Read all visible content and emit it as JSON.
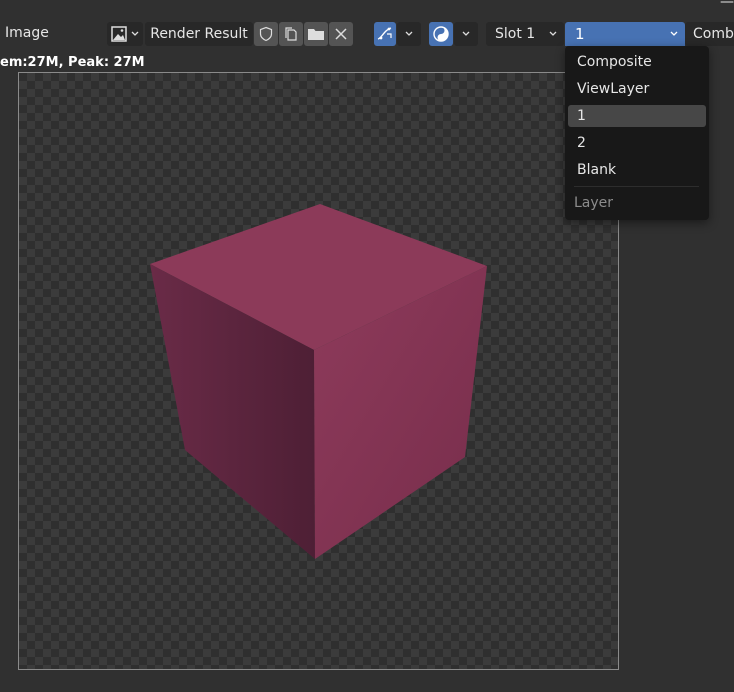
{
  "header": {
    "menu_label": "Image",
    "image_name": "Render Result",
    "slot_label": "Slot 1",
    "layer_selected": "1",
    "pass_label": "Combi",
    "window_minimize": "—"
  },
  "status": {
    "memory_text": "em:27M, Peak: 27M"
  },
  "layer_dropdown": {
    "items": [
      {
        "label": "Composite",
        "active": false
      },
      {
        "label": "ViewLayer",
        "active": false
      },
      {
        "label": "1",
        "active": true
      },
      {
        "label": "2",
        "active": false
      },
      {
        "label": "Blank",
        "active": false
      }
    ],
    "title": "Layer"
  },
  "colors": {
    "selected_field": "#4772b3",
    "cube_top": "#8a3b59",
    "cube_front": "#7c3150",
    "cube_left": "#5d263f"
  }
}
